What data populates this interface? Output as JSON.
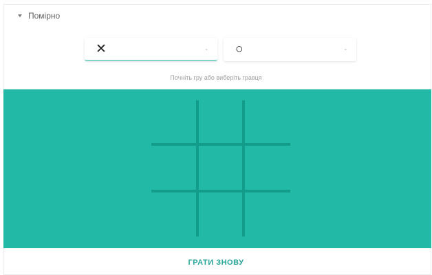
{
  "difficulty": {
    "label": "Помірно"
  },
  "players": {
    "x": {
      "mark": "✕",
      "arrow": "-"
    },
    "o": {
      "mark": "○",
      "arrow": "-"
    }
  },
  "hint": "Почніть гру або виберіть гравця",
  "board": {
    "cells": [
      "",
      "",
      "",
      "",
      "",
      "",
      "",
      "",
      ""
    ],
    "background": "#22b9a6",
    "line_color": "#139c8a"
  },
  "actions": {
    "play_again": "ГРАТИ ЗНОВУ"
  }
}
